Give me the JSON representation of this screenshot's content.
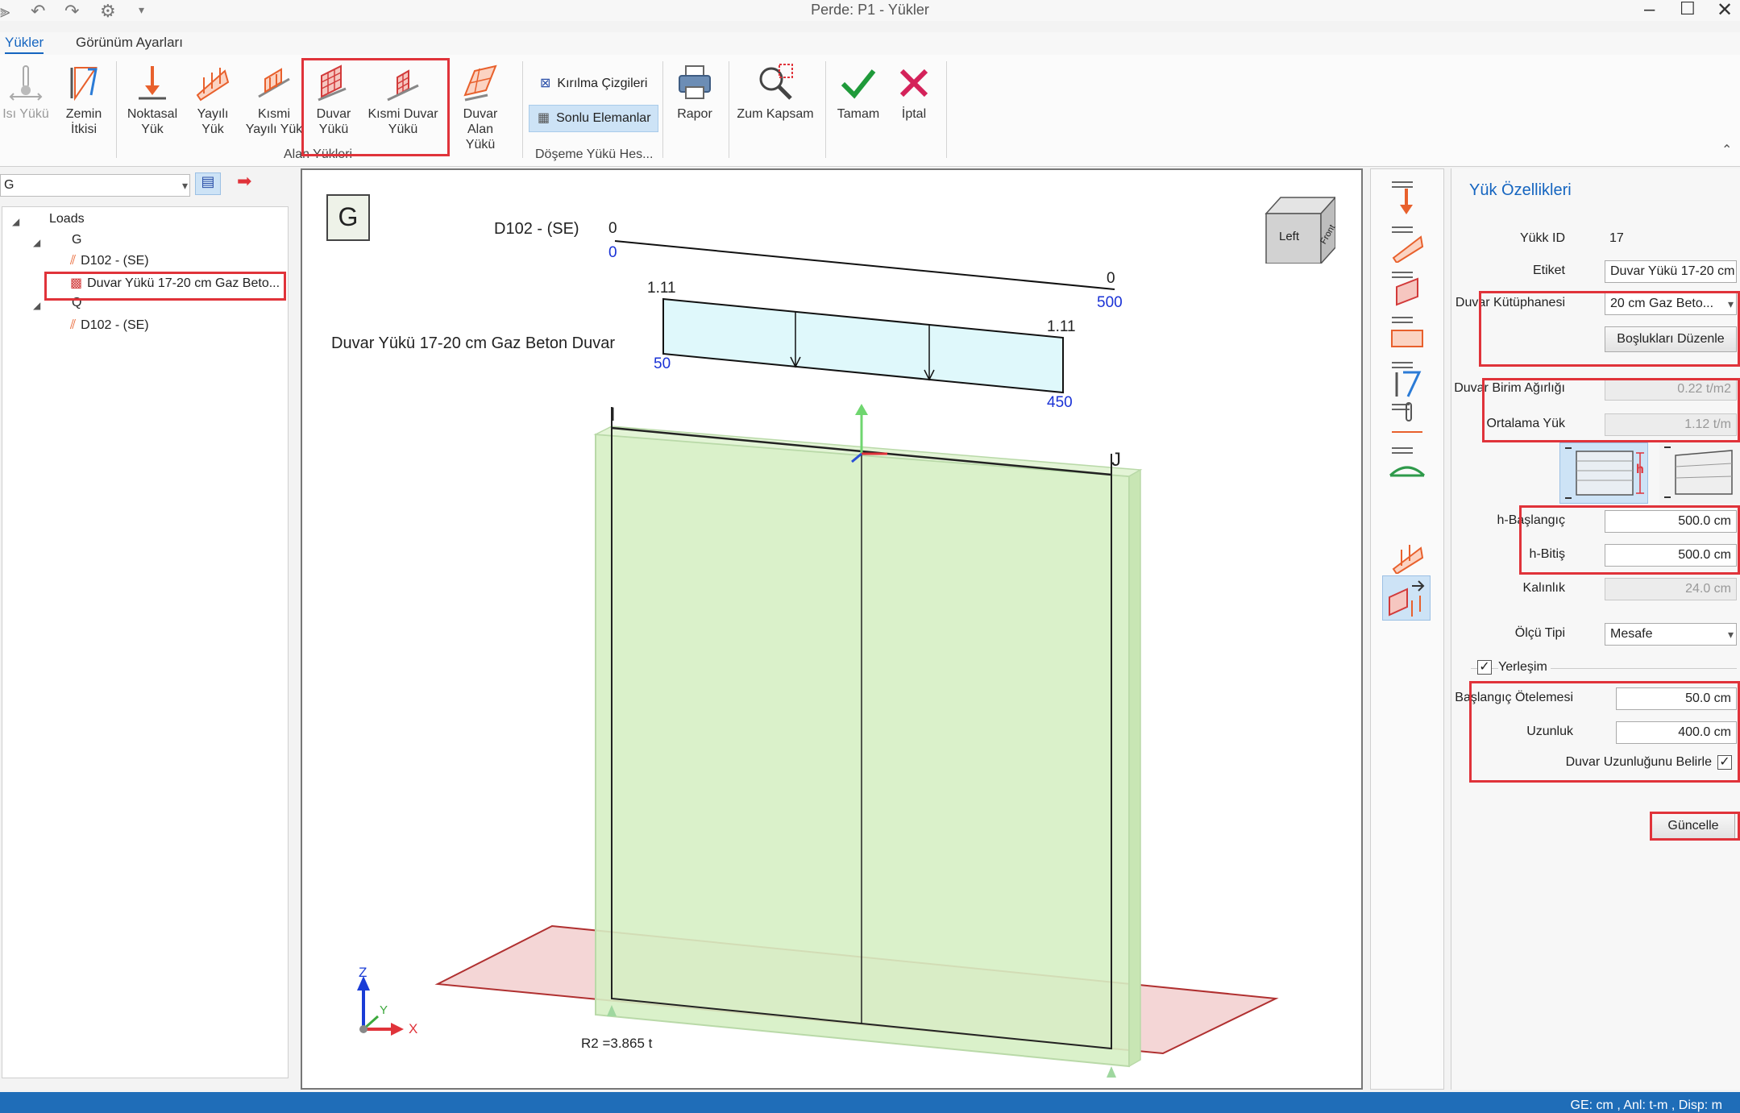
{
  "window": {
    "title": "Perde: P1 - Yükler"
  },
  "tabs": [
    {
      "label": "Yükler",
      "active": true
    },
    {
      "label": "Görünüm Ayarları",
      "active": false
    }
  ],
  "ribbon": {
    "buttons": {
      "isi": "Isı Yükü",
      "zemin": "Zemin İtkisi",
      "noktasal": "Noktasal Yük",
      "yayili": "Yayılı Yük",
      "kismi_yayili": "Kısmi Yayılı Yük",
      "duvar": "Duvar Yükü",
      "kismi_duvar": "Kısmi Duvar Yükü",
      "duvar_alan": "Duvar Alan Yükü",
      "rapor": "Rapor",
      "zum": "Zum Kapsam",
      "tamam": "Tamam",
      "iptal": "İptal"
    },
    "alan_group_label": "Alan Yükleri",
    "kirilma_label": "Kırılma Çizgileri",
    "sonlu_label": "Sonlu Elemanlar",
    "doseme_group_label": "Döşeme Yükü Hes..."
  },
  "left_panel": {
    "combo_value": "G",
    "tree": {
      "root": "Loads",
      "g": "G",
      "g_item1": "D102 - (SE)",
      "g_item2": "Duvar Yükü 17-20 cm Gaz Beto...",
      "q": "Q",
      "q_item1": "D102 - (SE)"
    }
  },
  "viewport": {
    "case_label": "G",
    "beam_label": "D102 - (SE)",
    "dist_start_top": "0",
    "dist_start_bottom": "0",
    "dist_end_top": "0",
    "dist_end_bottom": "500",
    "load_label": "Duvar Yükü 17-20 cm Gaz Beton Duvar",
    "load_start_value": "1.11",
    "load_end_value": "1.11",
    "load_start_pos": "50",
    "load_end_pos": "450",
    "node_i": "I",
    "node_j": "J",
    "reaction": "R2 =3.865 t",
    "navcube_left": "Left",
    "navcube_front": "Front",
    "axis_x": "X",
    "axis_y": "Y",
    "axis_z": "Z"
  },
  "properties": {
    "title": "Yük Özellikleri",
    "load_id_label": "Yükk ID",
    "load_id_value": "17",
    "etiket_label": "Etiket",
    "etiket_value": "Duvar Yükü 17-20 cm",
    "kutuphane_label": "Duvar Kütüphanesi",
    "kutuphane_value": "20 cm Gaz Beto...",
    "bosluk_button": "Boşlukları Düzenle",
    "birim_label": "Duvar Birim Ağırlığı",
    "birim_value": "0.22 t/m2",
    "ortalama_label": "Ortalama Yük",
    "ortalama_value": "1.12 t/m",
    "h_label": "h",
    "h_bas_label": "h-Başlangıç",
    "h_bas_value": "500.0 cm",
    "h_bit_label": "h-Bitiş",
    "h_bit_value": "500.0 cm",
    "kalinlik_label": "Kalınlık",
    "kalinlik_value": "24.0 cm",
    "olcu_label": "Ölçü Tipi",
    "olcu_value": "Mesafe",
    "yerlesim_label": "Yerleşim",
    "baslangic_label": "Başlangıç Ötelemesi",
    "baslangic_value": "50.0 cm",
    "uzunluk_label": "Uzunluk",
    "uzunluk_value": "400.0 cm",
    "duvar_uz_label": "Duvar Uzunluğunu Belirle",
    "guncelle_button": "Güncelle"
  },
  "status": {
    "units": "GE: cm , Anl: t-m , Disp: m"
  },
  "colors": {
    "accent": "#1565c0",
    "highlight": "#e0333a",
    "wall_fill": "#d6efc4",
    "load_fill": "#dff8fb",
    "slab_fill": "#f0c8c8",
    "status_bar": "#1f6db8"
  }
}
